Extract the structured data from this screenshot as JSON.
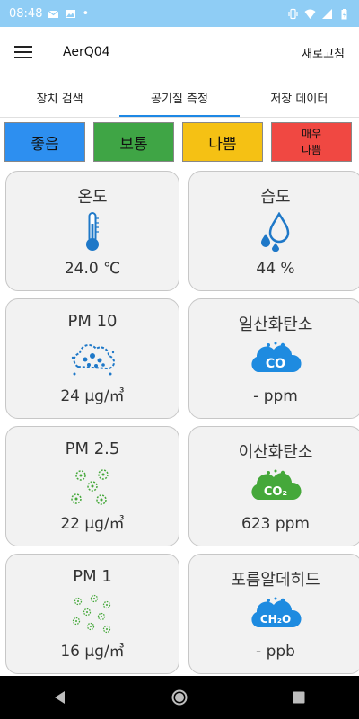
{
  "status_bar": {
    "time": "08:48",
    "dot": "•"
  },
  "app_bar": {
    "title": "AerQ04",
    "refresh_label": "새로고침"
  },
  "tabs": [
    {
      "label": "장치 검색",
      "active": false
    },
    {
      "label": "공기질 측정",
      "active": true
    },
    {
      "label": "저장 데이터",
      "active": false
    }
  ],
  "legend": [
    {
      "label": "좋음",
      "color": "#2d8ff0"
    },
    {
      "label": "보통",
      "color": "#3fa545"
    },
    {
      "label": "나쁨",
      "color": "#f5c114"
    },
    {
      "label": "매우\n나쁨",
      "color": "#f04842"
    }
  ],
  "cards": {
    "temperature": {
      "label": "온도",
      "value": "24.0 ℃",
      "icon": "thermometer-icon"
    },
    "humidity": {
      "label": "습도",
      "value": "44 %",
      "icon": "water-drops-icon"
    },
    "pm10": {
      "label": "PM 10",
      "value": "24 µg/㎥",
      "icon": "dust-cloud-icon"
    },
    "co": {
      "label": "일산화탄소",
      "value": "- ppm",
      "icon": "co-cloud-icon",
      "icon_text": "CO"
    },
    "pm25": {
      "label": "PM 2.5",
      "value": "22 µg/㎥",
      "icon": "fine-dust-icon"
    },
    "co2": {
      "label": "이산화탄소",
      "value": "623 ppm",
      "icon": "co2-cloud-icon",
      "icon_text": "CO₂"
    },
    "pm1": {
      "label": "PM 1",
      "value": "16 µg/㎥",
      "icon": "ultrafine-dust-icon"
    },
    "ch2o": {
      "label": "포름알데히드",
      "value": "- ppb",
      "icon": "ch2o-cloud-icon",
      "icon_text": "CH₂O"
    }
  },
  "colors": {
    "status_bar": "#8fcdf5",
    "accent": "#1e88e5",
    "cloud_blue": "#1e8be0",
    "cloud_green": "#45a83a"
  }
}
